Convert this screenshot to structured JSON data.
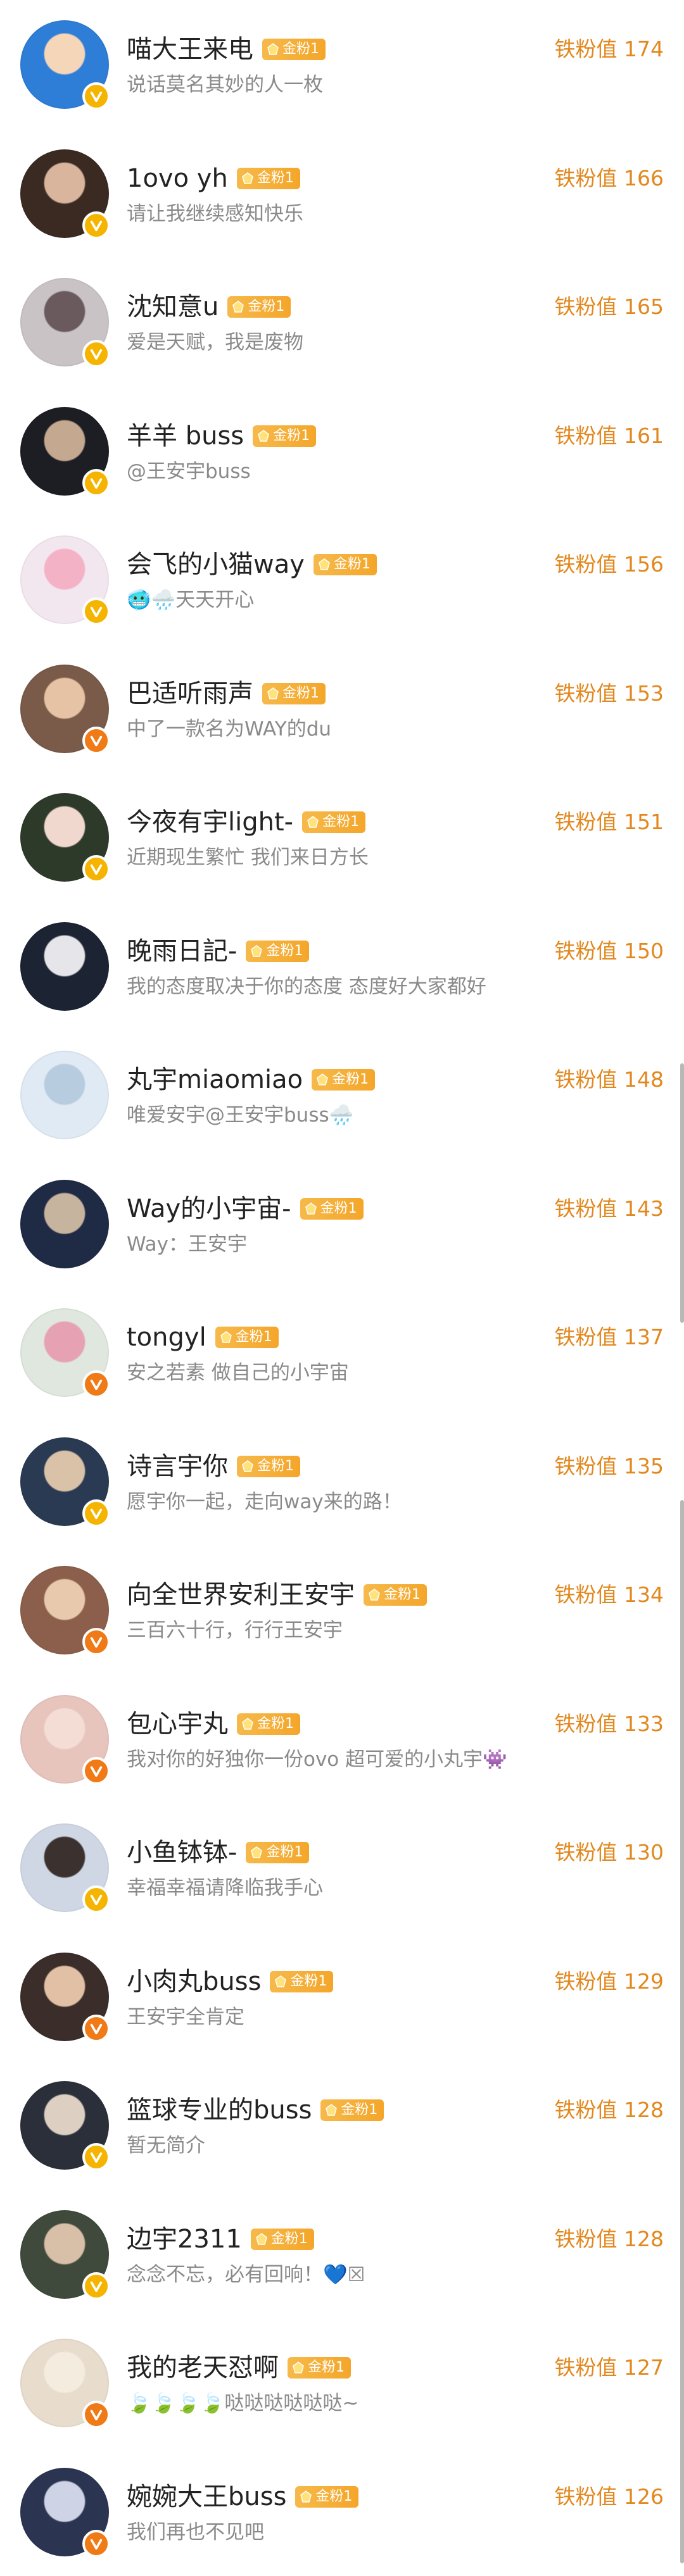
{
  "colors": {
    "accent": "#e2881e",
    "badge": "#f4a62a",
    "verified_yellow": "#f5b400",
    "verified_orange": "#ef7a16"
  },
  "score_prefix": "铁粉值",
  "fans": [
    {
      "name": "喵大王来电",
      "badge": "金粉1",
      "signature": "说话莫名其妙的人一枚",
      "score": "铁粉值 174",
      "verified": "yellow"
    },
    {
      "name": "1ovo  yh",
      "badge": "金粉1",
      "signature": "请让我继续感知快乐",
      "score": "铁粉值 166",
      "verified": "yellow"
    },
    {
      "name": "沈知意u",
      "badge": "金粉1",
      "signature": "爱是天赋，我是废物",
      "score": "铁粉值 165",
      "verified": "yellow"
    },
    {
      "name": "羊羊  buss",
      "badge": "金粉1",
      "signature": "@王安宇buss",
      "score": "铁粉值 161",
      "verified": "yellow"
    },
    {
      "name": "会飞的小猫way",
      "badge": "金粉1",
      "signature": "🥶🌧️天天开心",
      "score": "铁粉值 156",
      "verified": "yellow"
    },
    {
      "name": "巴适听雨声",
      "badge": "金粉1",
      "signature": "中了一款名为WAY的du",
      "score": "铁粉值 153",
      "verified": "orange"
    },
    {
      "name": "今夜有宇light-",
      "badge": "金粉1",
      "signature": "近期现生繁忙 我们来日方长",
      "score": "铁粉值 151",
      "verified": "yellow"
    },
    {
      "name": "晚雨日記-",
      "badge": "金粉1",
      "signature": "我的态度取决于你的态度 态度好大家都好",
      "score": "铁粉值 150",
      "verified": "none"
    },
    {
      "name": "丸宇miaomiao",
      "badge": "金粉1",
      "signature": "唯爱安宇@王安宇buss🌧️",
      "score": "铁粉值 148",
      "verified": "none"
    },
    {
      "name": "Way的小宇宙-",
      "badge": "金粉1",
      "signature": "Way：王安宇",
      "score": "铁粉值 143",
      "verified": "none"
    },
    {
      "name": "tongyl",
      "badge": "金粉1",
      "signature": "安之若素 做自己的小宇宙",
      "score": "铁粉值 137",
      "verified": "orange"
    },
    {
      "name": "诗言宇你",
      "badge": "金粉1",
      "signature": "愿宇你一起，走向way来的路！",
      "score": "铁粉值 135",
      "verified": "yellow"
    },
    {
      "name": "向全世界安利王安宇",
      "badge": "金粉1",
      "signature": "三百六十行，行行王安宇",
      "score": "铁粉值 134",
      "verified": "orange"
    },
    {
      "name": "包心宇丸",
      "badge": "金粉1",
      "signature": "我对你的好独你一份ovo 超可爱的小丸宇👾",
      "score": "铁粉值 133",
      "verified": "orange"
    },
    {
      "name": "小鱼钵钵-",
      "badge": "金粉1",
      "signature": "幸福幸福请降临我手心",
      "score": "铁粉值 130",
      "verified": "yellow"
    },
    {
      "name": "小肉丸buss",
      "badge": "金粉1",
      "signature": "王安宇全肯定",
      "score": "铁粉值 129",
      "verified": "orange"
    },
    {
      "name": "篮球专业的buss",
      "badge": "金粉1",
      "signature": "暂无简介",
      "score": "铁粉值 128",
      "verified": "yellow"
    },
    {
      "name": "边宇2311",
      "badge": "金粉1",
      "signature": "念念不忘，必有回响！💙☒",
      "score": "铁粉值 128",
      "verified": "yellow"
    },
    {
      "name": "我的老天怼啊",
      "badge": "金粉1",
      "signature": "🍃🍃🍃🍃哒哒哒哒哒哒~",
      "score": "铁粉值 127",
      "verified": "orange"
    },
    {
      "name": "婉婉大王buss",
      "badge": "金粉1",
      "signature": "我们再也不见吧",
      "score": "铁粉值 126",
      "verified": "orange"
    }
  ]
}
